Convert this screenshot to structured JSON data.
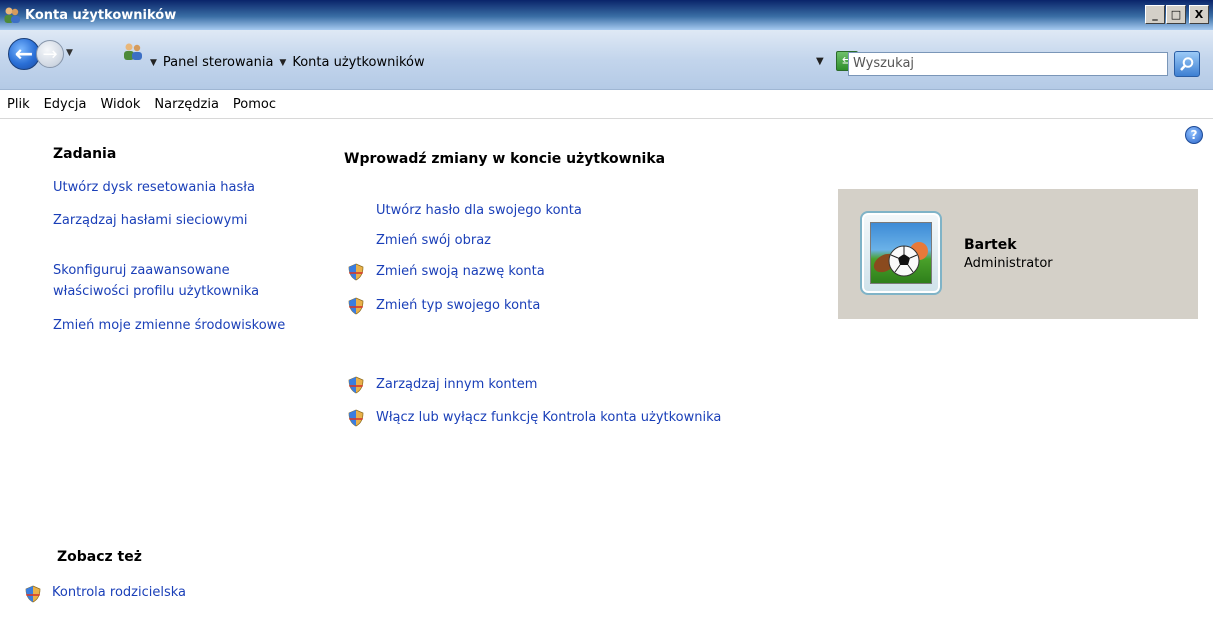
{
  "window": {
    "title": "Konta użytkowników",
    "controls": {
      "minimize": "_",
      "maximize": "□",
      "close": "X"
    }
  },
  "address_bar": {
    "breadcrumb": [
      "Panel sterowania",
      "Konta użytkowników"
    ],
    "search_placeholder": "Wyszukaj"
  },
  "menu": [
    "Plik",
    "Edycja",
    "Widok",
    "Narzędzia",
    "Pomoc"
  ],
  "tasks": {
    "heading": "Zadania",
    "links": [
      "Utwórz dysk resetowania hasła",
      "Zarządzaj hasłami sieciowymi",
      "Skonfiguruj zaawansowane",
      "właściwości profilu użytkownika",
      "Zmień moje zmienne środowiskowe"
    ]
  },
  "see_also": {
    "heading": "Zobacz też",
    "links": [
      "Kontrola rodzicielska"
    ]
  },
  "main": {
    "heading": "Wprowadź zmiany w koncie użytkownika",
    "links": [
      "Utwórz hasło dla swojego konta",
      "Zmień swój obraz",
      "Zmień swoją nazwę konta",
      "Zmień typ swojego konta"
    ],
    "other_links": [
      "Zarządzaj innym kontem",
      "Włącz lub wyłącz funkcję Kontrola konta użytkownika"
    ]
  },
  "user": {
    "name": "Bartek",
    "role": "Administrator"
  },
  "icons": {
    "help": "?",
    "back_arrow": "←",
    "forward_arrow": "→"
  }
}
